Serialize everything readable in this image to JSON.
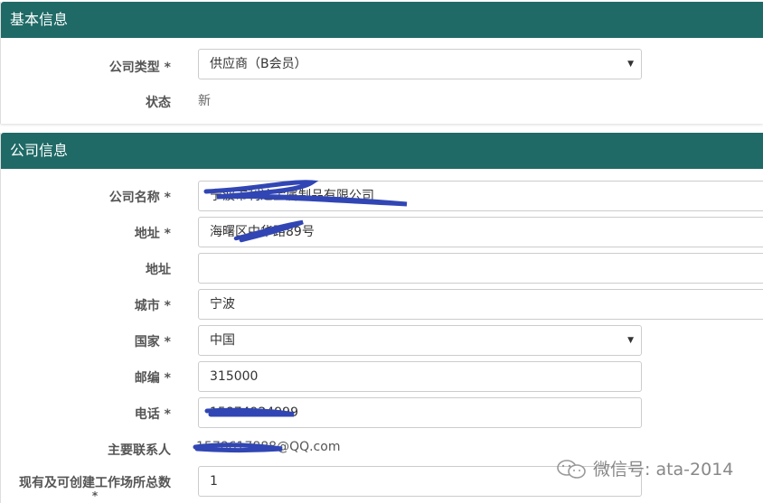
{
  "basic_info": {
    "header": "基本信息",
    "company_type": {
      "label": "公司类型 *",
      "value": "供应商（B会员）"
    },
    "status": {
      "label": "状态",
      "value": "新"
    }
  },
  "company_info": {
    "header": "公司信息",
    "company_name": {
      "label": "公司名称 *",
      "value": "宁波市利达金属制品有限公司"
    },
    "address1": {
      "label": "地址 *",
      "value": "海曙区中华路89号"
    },
    "address2": {
      "label": "地址",
      "value": ""
    },
    "city": {
      "label": "城市 *",
      "value": "宁波"
    },
    "country": {
      "label": "国家 *",
      "value": "中国"
    },
    "zip": {
      "label": "邮编 *",
      "value": "315000"
    },
    "phone": {
      "label": "电话 *",
      "value": "15874924999"
    },
    "contact": {
      "label": "主要联系人",
      "value": "1578617888@QQ.com"
    },
    "workplaces": {
      "label": "现有及可创建工作场所总数",
      "label_star": "*",
      "value": "1"
    }
  },
  "watermark": {
    "text": "微信号: ata-2014",
    "icon": "wechat-icon"
  },
  "colors": {
    "header_bg": "#1f6a66",
    "scribble": "#3146b4"
  }
}
